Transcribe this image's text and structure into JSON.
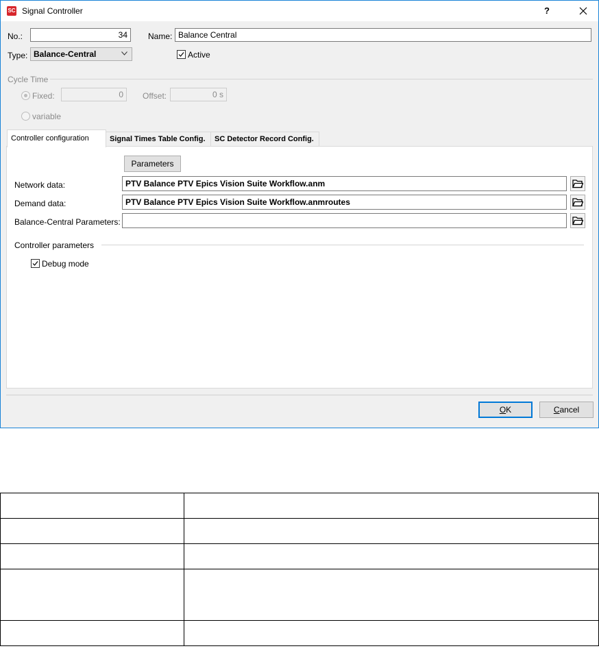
{
  "window": {
    "title": "Signal Controller",
    "app_icon_text": "SC",
    "help_label": "?",
    "icons": [
      "app-icon",
      "close-icon"
    ]
  },
  "form": {
    "no_label": "No.:",
    "no_value": "34",
    "name_label": "Name:",
    "name_value": "Balance Central",
    "type_label": "Type:",
    "type_value": "Balance-Central",
    "active_label": "Active",
    "active_checked": true
  },
  "cycle_time": {
    "section_label": "Cycle Time",
    "fixed_label": "Fixed:",
    "fixed_value": "0",
    "offset_label": "Offset:",
    "offset_value": "0 s",
    "variable_label": "variable"
  },
  "tabs": [
    {
      "label": "Controller configuration",
      "active": true
    },
    {
      "label": "Signal Times Table Config.",
      "active": false
    },
    {
      "label": "SC Detector Record Config.",
      "active": false
    }
  ],
  "config": {
    "parameters_button": "Parameters",
    "network_label": "Network data:",
    "network_value": "PTV Balance PTV Epics Vision Suite Workflow.anm",
    "demand_label": "Demand data:",
    "demand_value": "PTV Balance PTV Epics Vision Suite Workflow.anmroutes",
    "bc_params_label": "Balance-Central Parameters:",
    "bc_params_value": "",
    "controller_params_section": "Controller parameters",
    "debug_label": "Debug mode",
    "debug_checked": true
  },
  "footer": {
    "ok_mnemonic": "O",
    "ok_rest": "K",
    "cancel_mnemonic": "C",
    "cancel_rest": "ancel"
  },
  "table": {
    "rows": 5,
    "columns": 2
  },
  "colors": {
    "window_border": "#1883d7",
    "dialog_bg": "#f0f0f0",
    "default_button_border": "#0078d7",
    "app_icon": "#d7262c"
  }
}
